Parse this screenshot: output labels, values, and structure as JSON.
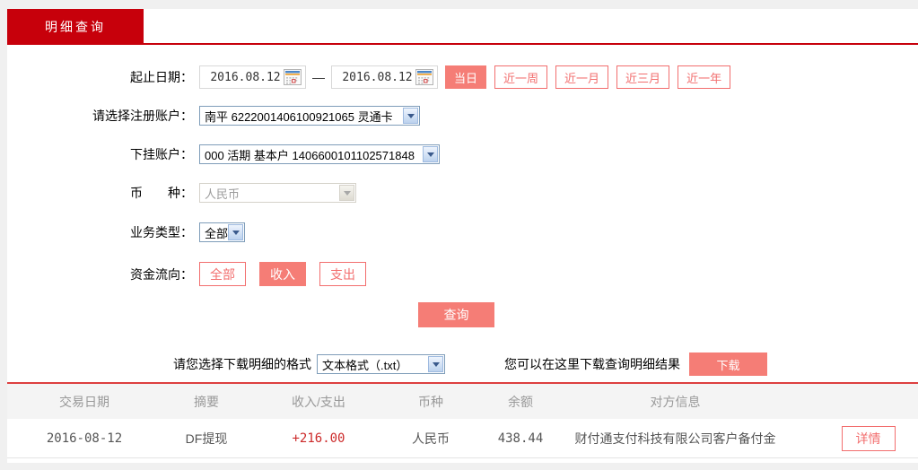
{
  "colors": {
    "red": "#c7000b",
    "tableline": "#dd4040",
    "pink-fill": "#f57d76",
    "pink-line": "#f26e6e",
    "amount-red": "#cc2a2a",
    "sel-border": "#7f9db9"
  },
  "icons": {
    "calendar": "calendar-grid",
    "select_arrow": "chevron-down-triangle"
  },
  "tab": {
    "label": "明细查询"
  },
  "form": {
    "date_row": {
      "label": "起止日期：",
      "start_date": "2016.08.12",
      "separator": "—",
      "end_date": "2016.08.12",
      "quick_ranges": [
        {
          "label": "当日",
          "active": true
        },
        {
          "label": "近一周",
          "active": false
        },
        {
          "label": "近一月",
          "active": false
        },
        {
          "label": "近三月",
          "active": false
        },
        {
          "label": "近一年",
          "active": false
        }
      ]
    },
    "register_account": {
      "label": "请选择注册账户：",
      "value": "南平 6222001406100921065 灵通卡"
    },
    "sub_account": {
      "label": "下挂账户：",
      "value": "000 活期 基本户 1406600101102571848"
    },
    "currency": {
      "label": "币　　种：",
      "value": "人民币",
      "disabled": true
    },
    "business_type": {
      "label": "业务类型：",
      "value": "全部"
    },
    "fund_flow": {
      "label": "资金流向：",
      "options": [
        {
          "label": "全部",
          "active": false
        },
        {
          "label": "收入",
          "active": true
        },
        {
          "label": "支出",
          "active": false
        }
      ]
    },
    "query_button": "查询",
    "download": {
      "format_label": "请您选择下载明细的格式",
      "format_value": "文本格式（.txt）",
      "hint": "您可以在这里下载查询明细结果",
      "button": "下载"
    }
  },
  "table": {
    "headers": [
      "交易日期",
      "摘要",
      "收入/支出",
      "币种",
      "余额",
      "对方信息"
    ],
    "rows": [
      {
        "date": "2016-08-12",
        "summary": "DF提现",
        "amount": "+216.00",
        "currency": "人民币",
        "balance": "438.44",
        "counterparty": "财付通支付科技有限公司客户备付金",
        "detail_button": "详情"
      }
    ]
  }
}
